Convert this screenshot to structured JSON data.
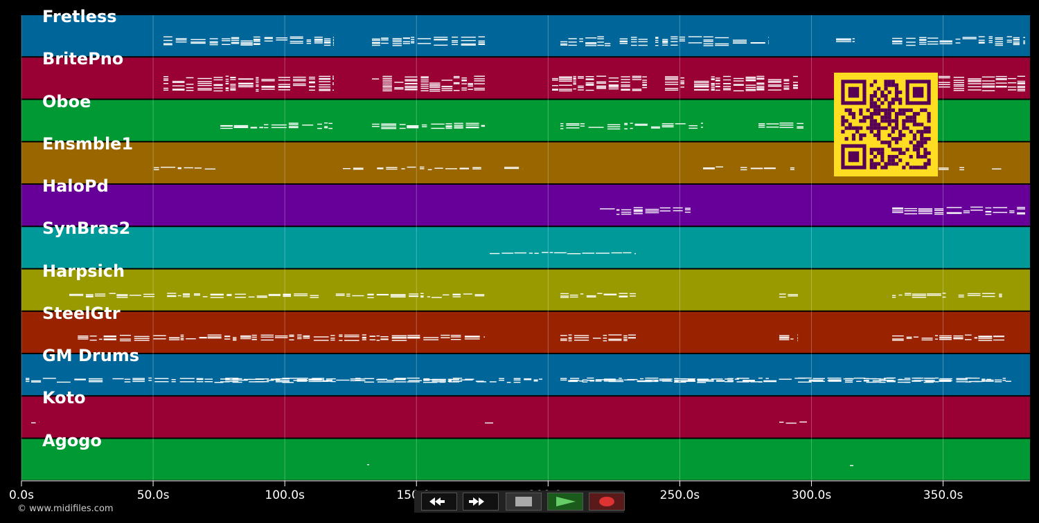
{
  "tracks": [
    {
      "name": "Fretless",
      "color": "#006699"
    },
    {
      "name": "BritePno",
      "color": "#990033"
    },
    {
      "name": "Oboe",
      "color": "#009933"
    },
    {
      "name": "Ensmble1",
      "color": "#996600"
    },
    {
      "name": "HaloPd",
      "color": "#660099"
    },
    {
      "name": "SynBras2",
      "color": "#009999"
    },
    {
      "name": "Harpsich",
      "color": "#999900"
    },
    {
      "name": "SteelGtr",
      "color": "#992200"
    },
    {
      "name": "GM Drums",
      "color": "#006699"
    },
    {
      "name": "Koto",
      "color": "#990033"
    },
    {
      "name": "Agogo",
      "color": "#009933"
    }
  ],
  "timeline": {
    "max_seconds": 383,
    "ticks": [
      "0.0s",
      "50.0s",
      "100.0s",
      "150.0s",
      "200.0s",
      "250.0s",
      "300.0s",
      "350.0s"
    ],
    "tick_values": [
      0,
      50,
      100,
      150,
      200,
      250,
      300,
      350
    ]
  },
  "copyright": "© www.midifiles.com",
  "qr_code": {
    "fg": "#550055",
    "bg": "#ffdd22"
  },
  "transport": {
    "rewind": "rewind-icon",
    "fast_forward": "fast-forward-icon",
    "stop": "stop-icon",
    "play": "play-icon",
    "record": "record-icon"
  }
}
